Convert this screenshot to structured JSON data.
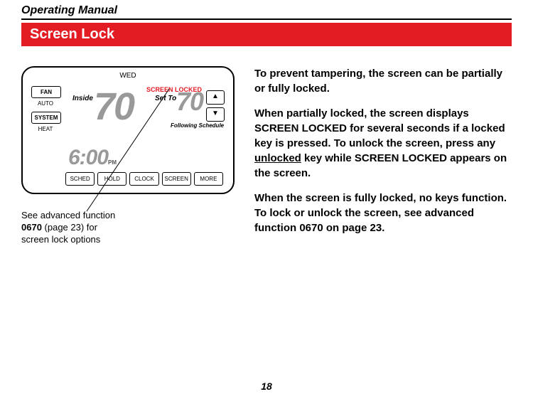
{
  "header": "Operating Manual",
  "banner": "Screen Lock",
  "thermostat": {
    "day": "WED",
    "locked_label": "SCREEN LOCKED",
    "inside_label": "Inside",
    "inside_temp": "70",
    "setto_label": "Set To",
    "set_temp": "70",
    "follow": "Following\nSchedule",
    "time": "6:00",
    "ampm": "PM",
    "fan_btn": "FAN",
    "fan_mode": "AUTO",
    "system_btn": "SYSTEM",
    "system_mode": "HEAT",
    "up": "▲",
    "down": "▼",
    "bottom": [
      "SCHED",
      "HOLD",
      "CLOCK",
      "SCREEN",
      "MORE"
    ]
  },
  "caption": {
    "line1": "See advanced function",
    "code": "0670",
    "line2": " (page 23) for",
    "line3": "screen lock options"
  },
  "body": {
    "p1": "To prevent tampering, the screen can be partially or fully locked.",
    "p2a": "When partially locked, the screen displays ",
    "p2b": "SCREEN LOCKED",
    "p2c": " for several seconds if a locked key is pressed. To unlock the screen, press any ",
    "p2d": "unlocked",
    "p2e": " key while ",
    "p2f": "SCREEN LOCKED",
    "p2g": " appears on the screen.",
    "p3a": "When the screen is fully locked, no keys function. To lock or unlock the screen, see advanced function ",
    "p3b": "0670",
    "p3c": " on page 23."
  },
  "page_number": "18"
}
